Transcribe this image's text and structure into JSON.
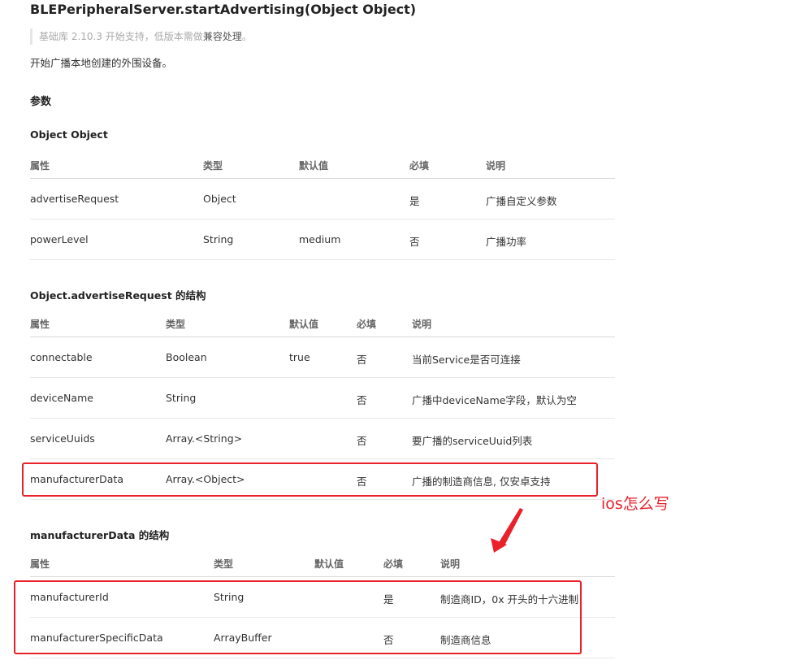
{
  "title": "BLEPeripheralServer.startAdvertising(Object Object)",
  "note": {
    "text_prefix": "基础库 2.10.3 开始支持，低版本需做",
    "link": "兼容处理",
    "text_suffix": "。"
  },
  "description": "开始广播本地创建的外围设备。",
  "params_heading": "参数",
  "table1": {
    "heading": "Object Object",
    "headers": [
      "属性",
      "类型",
      "默认值",
      "必填",
      "说明"
    ],
    "rows": [
      [
        "advertiseRequest",
        "Object",
        "",
        "是",
        "广播自定义参数"
      ],
      [
        "powerLevel",
        "String",
        "medium",
        "否",
        "广播功率"
      ]
    ]
  },
  "table2": {
    "heading": "Object.advertiseRequest 的结构",
    "headers": [
      "属性",
      "类型",
      "默认值",
      "必填",
      "说明"
    ],
    "rows": [
      [
        "connectable",
        "Boolean",
        "true",
        "否",
        "当前Service是否可连接"
      ],
      [
        "deviceName",
        "String",
        "",
        "否",
        "广播中deviceName字段，默认为空"
      ],
      [
        "serviceUuids",
        "Array.<String>",
        "",
        "否",
        "要广播的serviceUuid列表"
      ],
      [
        "manufacturerData",
        "Array.<Object>",
        "",
        "否",
        "广播的制造商信息, 仅安卓支持"
      ]
    ]
  },
  "table3": {
    "heading": "manufacturerData 的结构",
    "headers": [
      "属性",
      "类型",
      "默认值",
      "必填",
      "说明"
    ],
    "rows": [
      [
        "manufacturerId",
        "String",
        "",
        "是",
        "制造商ID，0x 开头的十六进制"
      ],
      [
        "manufacturerSpecificData",
        "ArrayBuffer",
        "",
        "否",
        "制造商信息"
      ]
    ]
  },
  "annotation": {
    "text": "ios怎么写",
    "color": "#e8212b"
  }
}
